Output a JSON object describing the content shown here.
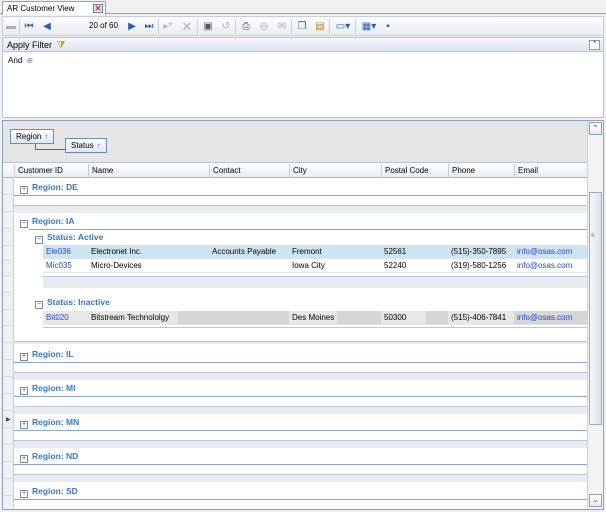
{
  "tab": {
    "title": "AR Customer View",
    "close": "✕"
  },
  "toolbar": {
    "pager_text": "20 of 60",
    "icons": [
      "save-icon",
      "first-record-icon",
      "previous-record-icon",
      "next-record-icon",
      "last-record-icon",
      "add-record-icon",
      "delete-record-icon",
      "edit-icon",
      "refresh-icon",
      "print-preview-icon",
      "filter-icon",
      "mail-icon",
      "copy-icon",
      "paste-icon",
      "export-icon",
      "chart-icon",
      "layout-icon"
    ]
  },
  "filter": {
    "title": "Apply Filter",
    "operator": "And",
    "add_glyph": "⊕",
    "collapse_glyph": "⌃"
  },
  "grouping": {
    "chips": [
      {
        "label": "Region",
        "arrow": "↑"
      },
      {
        "label": "Status",
        "arrow": "↑"
      }
    ]
  },
  "columns": [
    "Customer ID",
    "Name",
    "Contact",
    "City",
    "Postal Code",
    "Phone",
    "Email"
  ],
  "groups": {
    "de": "Region: DE",
    "ia": "Region: IA",
    "ia_active": "Status: Active",
    "ia_inactive": "Status: Inactive",
    "il": "Region: IL",
    "mi": "Region: MI",
    "mn": "Region: MN",
    "nd": "Region: ND",
    "sd": "Region: SD"
  },
  "rows": [
    {
      "id": "Ele036",
      "name": "Electronet Inc.",
      "contact": "Accounts Payable",
      "city": "Fremont",
      "postal": "52561",
      "phone": "(515)-350-7895",
      "email": "info@osas.com"
    },
    {
      "id": "Mic035",
      "name": "Micro-Devices",
      "contact": "",
      "city": "Iowa City",
      "postal": "52240",
      "phone": "(319)-580-1256",
      "email": "info@osas.com"
    },
    {
      "id": "Bit020",
      "name": "Bitstream Technololgy",
      "contact": "",
      "city": "Des Moines",
      "postal": "50300",
      "phone": "(515)-406-7841",
      "email": "info@osas.com"
    }
  ],
  "colors": {
    "accent": "#3877c5",
    "link": "#2348c8",
    "selected_row": "#cfe4f2"
  }
}
